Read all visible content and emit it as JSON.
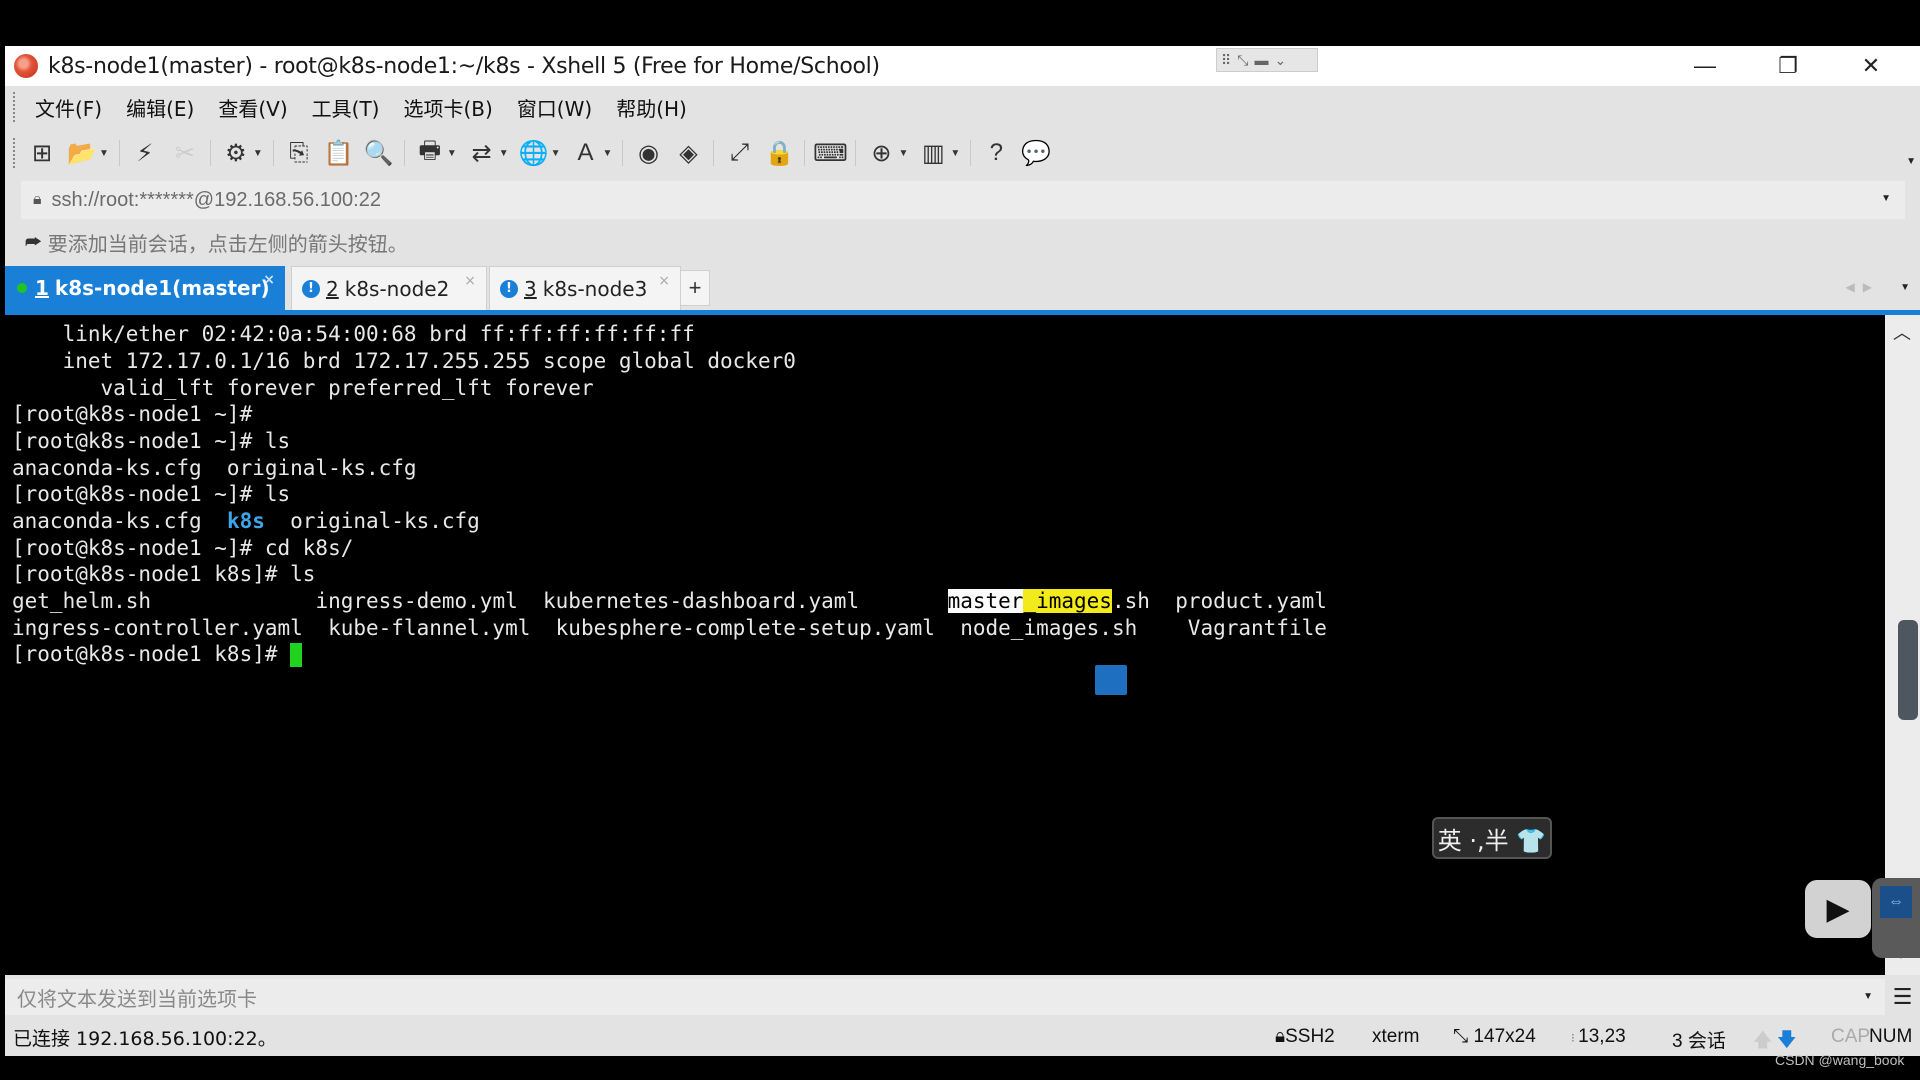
{
  "window": {
    "title": "k8s-node1(master) - root@k8s-node1:~/k8s - Xshell 5 (Free for Home/School)",
    "controls": {
      "minimize": "—",
      "restore": "❐",
      "close": "✕"
    }
  },
  "menu": [
    "文件(F)",
    "编辑(E)",
    "查看(V)",
    "工具(T)",
    "选项卡(B)",
    "窗口(W)",
    "帮助(H)"
  ],
  "toolbar": {
    "icons": [
      {
        "name": "new-session-icon",
        "glyph": "⊞",
        "dropdown": false
      },
      {
        "name": "open-folder-icon",
        "glyph": "📂",
        "dropdown": true
      },
      {
        "name": "connect-icon",
        "glyph": "⚡",
        "dropdown": false
      },
      {
        "name": "disconnect-icon",
        "glyph": "✂",
        "dropdown": false
      },
      {
        "name": "session-properties-icon",
        "glyph": "⚙",
        "dropdown": true
      },
      {
        "name": "copy-icon",
        "glyph": "⎘",
        "dropdown": false
      },
      {
        "name": "paste-icon",
        "glyph": "📋",
        "dropdown": false
      },
      {
        "name": "find-icon",
        "glyph": "🔍",
        "dropdown": false
      },
      {
        "name": "print-icon",
        "glyph": "🖶",
        "dropdown": true
      },
      {
        "name": "transfer-icon",
        "glyph": "⇄",
        "dropdown": true
      },
      {
        "name": "globe-icon",
        "glyph": "🌐",
        "dropdown": true
      },
      {
        "name": "font-icon",
        "glyph": "A",
        "dropdown": true
      },
      {
        "name": "xshell-icon",
        "glyph": "◉",
        "dropdown": false
      },
      {
        "name": "xftp-icon",
        "glyph": "◈",
        "dropdown": false
      },
      {
        "name": "fullscreen-icon",
        "glyph": "⤢",
        "dropdown": false
      },
      {
        "name": "lock-icon",
        "glyph": "🔒",
        "dropdown": false
      },
      {
        "name": "keyboard-icon",
        "glyph": "⌨",
        "dropdown": false
      },
      {
        "name": "new-tab-folder-icon",
        "glyph": "⊕",
        "dropdown": true
      },
      {
        "name": "layout-icon",
        "glyph": "▥",
        "dropdown": true
      },
      {
        "name": "help-icon",
        "glyph": "?",
        "dropdown": false
      },
      {
        "name": "chat-icon",
        "glyph": "💬",
        "dropdown": false
      }
    ]
  },
  "address": {
    "value": "ssh://root:*******@192.168.56.100:22"
  },
  "hint": {
    "text": "要添加当前会话，点击左侧的箭头按钮。"
  },
  "tabs": [
    {
      "num": "1",
      "label": "k8s-node1(master)",
      "active": true,
      "status": "connected"
    },
    {
      "num": "2",
      "label": "k8s-node2",
      "active": false,
      "status": "warning"
    },
    {
      "num": "3",
      "label": "k8s-node3",
      "active": false,
      "status": "warning"
    }
  ],
  "tab_add": "+",
  "terminal": {
    "lines": [
      "    link/ether 02:42:0a:54:00:68 brd ff:ff:ff:ff:ff:ff",
      "    inet 172.17.0.1/16 brd 172.17.255.255 scope global docker0",
      "       valid_lft forever preferred_lft forever",
      "[root@k8s-node1 ~]#",
      "[root@k8s-node1 ~]# ls",
      "anaconda-ks.cfg  original-ks.cfg",
      "[root@k8s-node1 ~]# ls"
    ],
    "ls_home": {
      "a": "anaconda-ks.cfg  ",
      "dir": "k8s",
      "b": "  original-ks.cfg"
    },
    "lines2": [
      "[root@k8s-node1 ~]# cd k8s/",
      "[root@k8s-node1 k8s]# ls"
    ],
    "ls_k8s_row1": {
      "c1": "get_helm.sh             ",
      "c2": "ingress-demo.yml  ",
      "c3": "kubernetes-dashboard.yaml       ",
      "c4a": "master",
      "c4b": "_images",
      "c4c": ".sh  ",
      "c5": "product.yaml"
    },
    "ls_k8s_row2": "ingress-controller.yaml  kube-flannel.yml  kubesphere-complete-setup.yaml  node_images.sh    Vagrantfile",
    "prompt": "[root@k8s-node1 k8s]# "
  },
  "ime": {
    "text": "英 ·,半 👕"
  },
  "send_bar": {
    "placeholder": "仅将文本发送到当前选项卡"
  },
  "status": {
    "connection": "已连接 192.168.56.100:22。",
    "protocol": "SSH2",
    "term": "xterm",
    "size": "147x24",
    "cursor_pos": "13,23",
    "sessions": "3 会话",
    "cap": "CAP",
    "num": "NUM"
  },
  "watermark": "CSDN @wang_book"
}
